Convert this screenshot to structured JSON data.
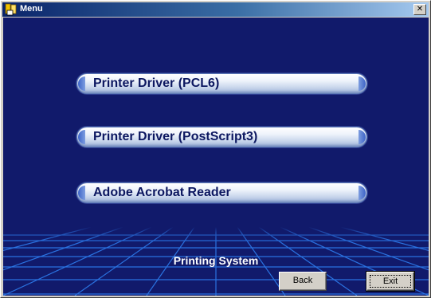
{
  "window": {
    "title": "Menu",
    "close_label": "✕"
  },
  "menu": {
    "buttons": [
      {
        "label": "Printer Driver (PCL6)"
      },
      {
        "label": "Printer Driver (PostScript3)"
      },
      {
        "label": "Adobe Acrobat Reader"
      }
    ]
  },
  "footer": {
    "title": "Printing System",
    "back_label": "Back",
    "exit_label": "Exit"
  },
  "colors": {
    "background": "#111a6b",
    "grid": "#2a72e0",
    "titlebar_start": "#0a246a"
  }
}
